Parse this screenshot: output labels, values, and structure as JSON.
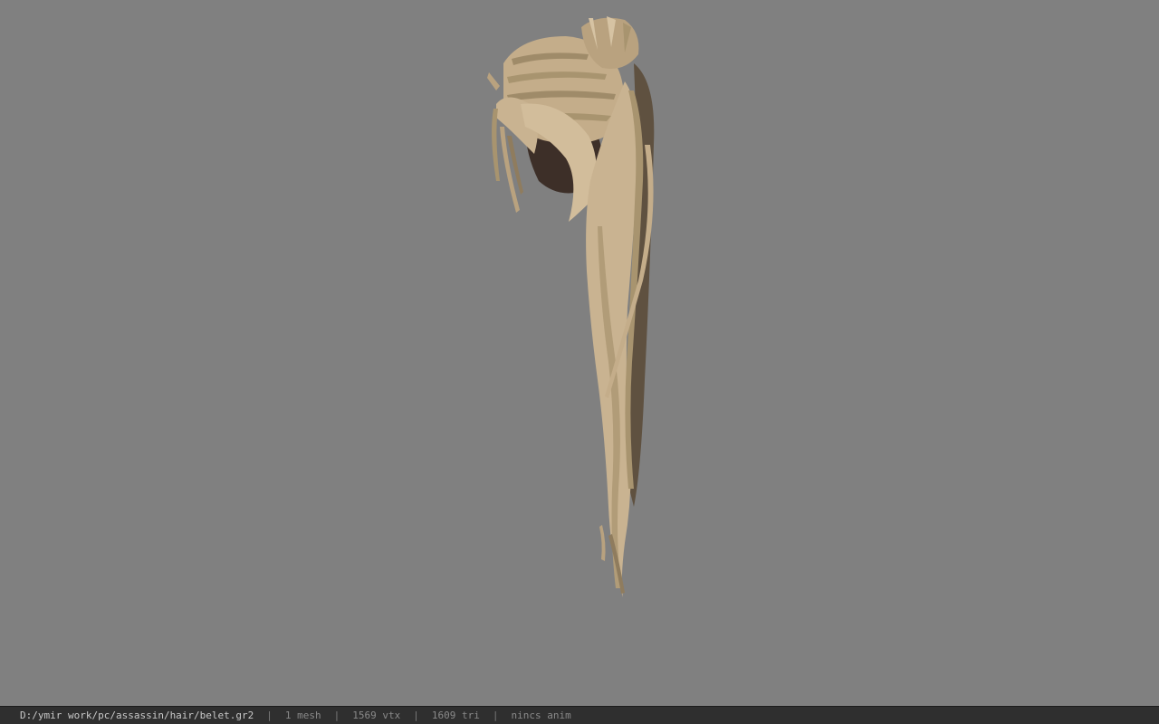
{
  "viewport": {
    "background_color": "#808080",
    "model_icon": "hair-mesh-icon"
  },
  "statusbar": {
    "file_path": "D:/ymir work/pc/assassin/hair/belet.gr2",
    "mesh_count": "1 mesh",
    "vertex_count": "1569 vtx",
    "triangle_count": "1609 tri",
    "anim_status": "nincs anim"
  },
  "colors": {
    "hair_light": "#c9b391",
    "hair_mid": "#a8946f",
    "hair_dark": "#5f5140",
    "scalp": "#3d2f28",
    "statusbar_bg": "#2f2f2f"
  }
}
